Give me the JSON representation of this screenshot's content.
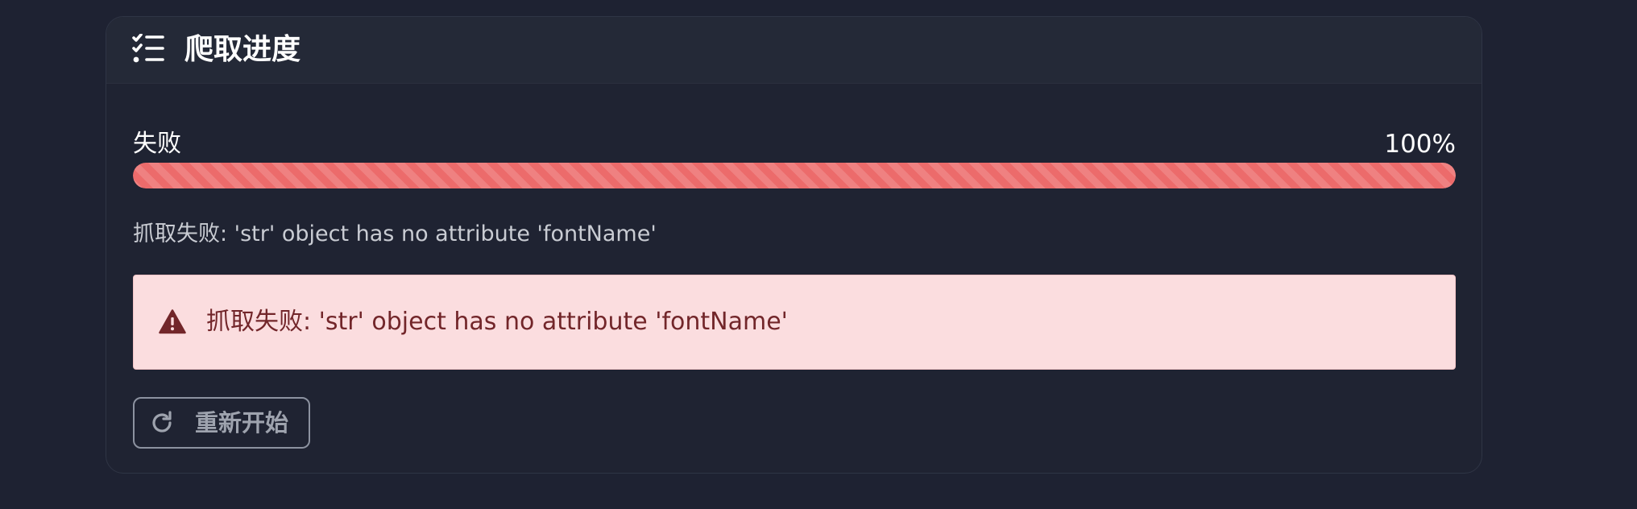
{
  "card": {
    "title": "爬取进度",
    "title_icon": "checklist-icon"
  },
  "progress": {
    "status_label": "失败",
    "percent_label": "100%",
    "fraction": 1.0,
    "fill_color": "#ec6b6b"
  },
  "message": {
    "text": "抓取失败: 'str' object has no attribute 'fontName'"
  },
  "alert": {
    "icon": "warning-triangle-icon",
    "text": "抓取失败: 'str' object has no attribute 'fontName'",
    "background_color": "#fbdddf",
    "text_color": "#72262a"
  },
  "restart_button": {
    "icon": "refresh-icon",
    "label": "重新开始"
  }
}
